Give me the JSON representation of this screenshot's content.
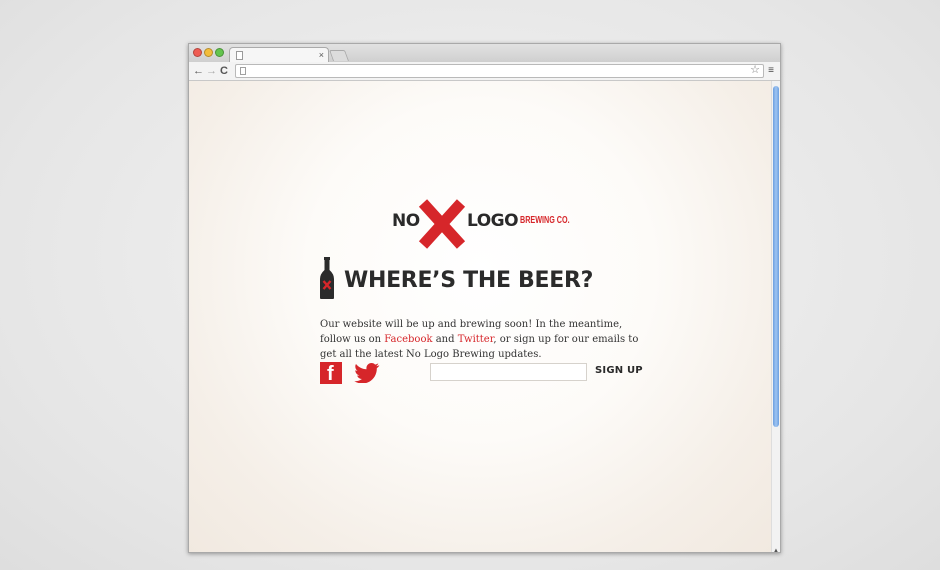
{
  "browser": {
    "tab_close": "×",
    "menu_glyph": "≡",
    "back_glyph": "←",
    "forward_glyph": "→",
    "reload_glyph": "C",
    "star_glyph": "☆",
    "scroll_down_glyph": "▲"
  },
  "page": {
    "logo": {
      "no": "NO",
      "logo": "LOGO",
      "brewing": "BREWING CO."
    },
    "heading": "WHERE’S THE BEER?",
    "description": {
      "part1": "Our website will be up and brewing soon! In the meantime, follow us on ",
      "facebook_link": "Facebook",
      "part2": " and ",
      "twitter_link": "Twitter",
      "part3": ", or sign up for our emails to get all the latest No Logo Brewing updates."
    },
    "social": {
      "facebook_glyph": "f"
    },
    "signup": {
      "input_value": "",
      "button_label": "SIGN UP"
    }
  },
  "colors": {
    "accent": "#d6262a",
    "text": "#2b2b2b"
  }
}
